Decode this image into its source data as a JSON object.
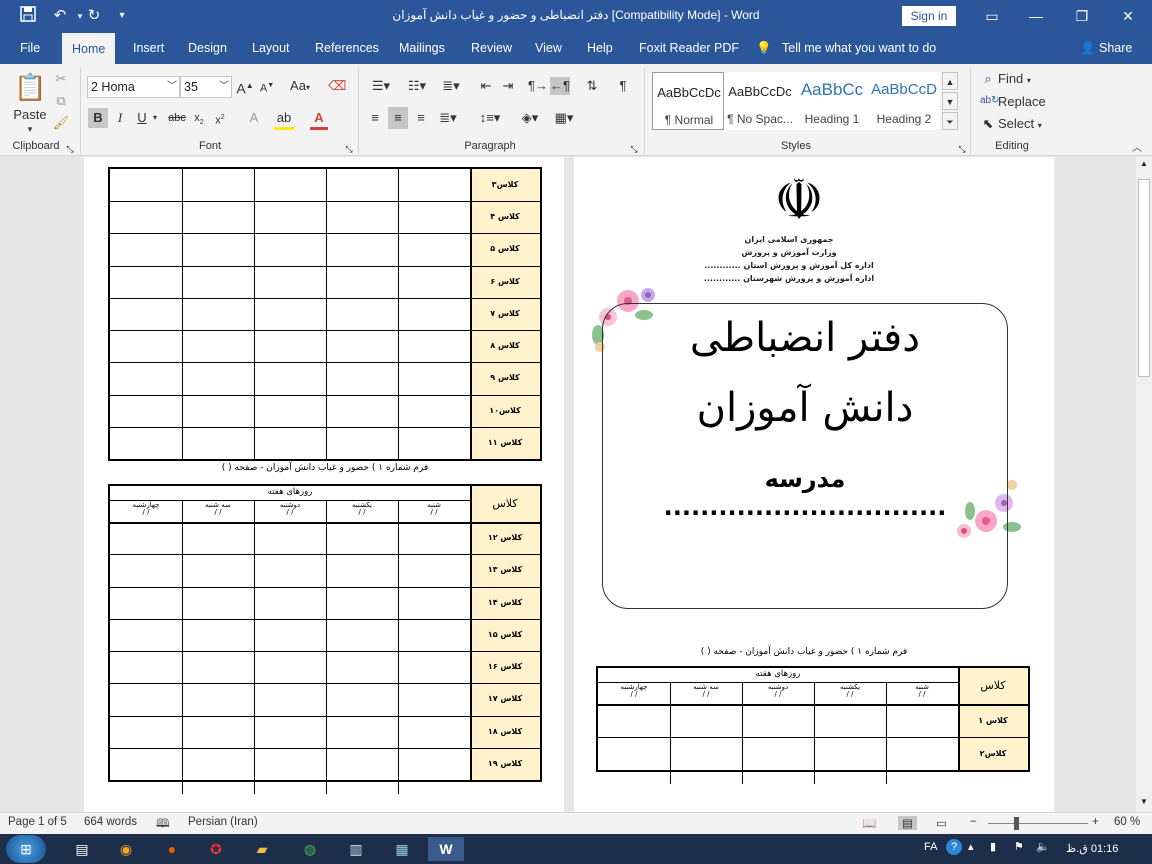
{
  "titlebar": {
    "title": "دفتر انضباطی و حضور و غیاب دانش آموزان [Compatibility Mode]  -  Word",
    "signin": "Sign in",
    "save_icon": "save-icon",
    "undo_icon": "undo-icon",
    "redo_icon": "redo-icon",
    "customize_icon": "chevron-down-icon"
  },
  "tabs": [
    "File",
    "Home",
    "Insert",
    "Design",
    "Layout",
    "References",
    "Mailings",
    "Review",
    "View",
    "Help",
    "Foxit Reader PDF"
  ],
  "tellme": "Tell me what you want to do",
  "share": "Share",
  "ribbon": {
    "clipboard": {
      "paste": "Paste",
      "label": "Clipboard"
    },
    "font": {
      "name": "2  Homa",
      "size": "35",
      "aa": "Aa",
      "label": "Font"
    },
    "paragraph": {
      "label": "Paragraph"
    },
    "styles": {
      "label": "Styles",
      "items": [
        {
          "sample": "AaBbCcDc",
          "name": "¶ Normal"
        },
        {
          "sample": "AaBbCcDc",
          "name": "¶ No Spac..."
        },
        {
          "sample": "AaBbCc",
          "name": "Heading 1"
        },
        {
          "sample": "AaBbCcD",
          "name": "Heading 2"
        }
      ]
    },
    "editing": {
      "find": "Find",
      "replace": "Replace",
      "select": "Select",
      "label": "Editing"
    }
  },
  "left_page": {
    "top_classes": [
      "کلاس۳",
      "کلاس ۴",
      "کلاس ۵",
      "کلاس ۶",
      "کلاس ۷",
      "کلاس ۸",
      "کلاس ۹",
      "کلاس۱۰",
      "کلاس ۱۱"
    ],
    "caption": "فرم شماره ۱ ) حضور و غیاب دانش آموزان - صفحه (         )",
    "header_title": "روزهای هفته",
    "header_class": "کلاس",
    "days": [
      "شنبه",
      "یکشنبه",
      "دوشنبه",
      "سه شنبه",
      "چهارشنبه"
    ],
    "date_slashes": "/      /",
    "bottom_classes": [
      "کلاس ۱۲",
      "کلاس ۱۳",
      "کلاس ۱۴",
      "کلاس ۱۵",
      "کلاس ۱۶",
      "کلاس ۱۷",
      "کلاس ۱۸",
      "کلاس ۱۹"
    ]
  },
  "right_page": {
    "emblem": "☫",
    "header_lines": [
      "جمهوری اسلامی ایران",
      "وزارت آموزش و پرورش",
      "اداره کل آموزش و پرورش استان ............",
      "اداره آموزش و پرورش شهرستان ............"
    ],
    "title1": "دفتر انضباطی",
    "title2": "دانش آموزان",
    "school": "مدرسه ...............................",
    "caption": "فرم شماره ۱ ) حضور و غیاب دانش آموزان - صفحه (       )",
    "header_title": "روزهای هفته",
    "header_class": "کلاس",
    "days": [
      "شنبه",
      "یکشنبه",
      "دوشنبه",
      "سه شنبه",
      "چهارشنبه"
    ],
    "date_slashes": "/      /",
    "classes": [
      "کلاس ۱",
      "کلاس۲"
    ]
  },
  "statusbar": {
    "page": "Page 1 of 5",
    "words": "664 words",
    "language": "Persian (Iran)",
    "zoom": "60 %"
  },
  "taskbar": {
    "lang": "FA",
    "time": "01:16 ق.ظ"
  }
}
